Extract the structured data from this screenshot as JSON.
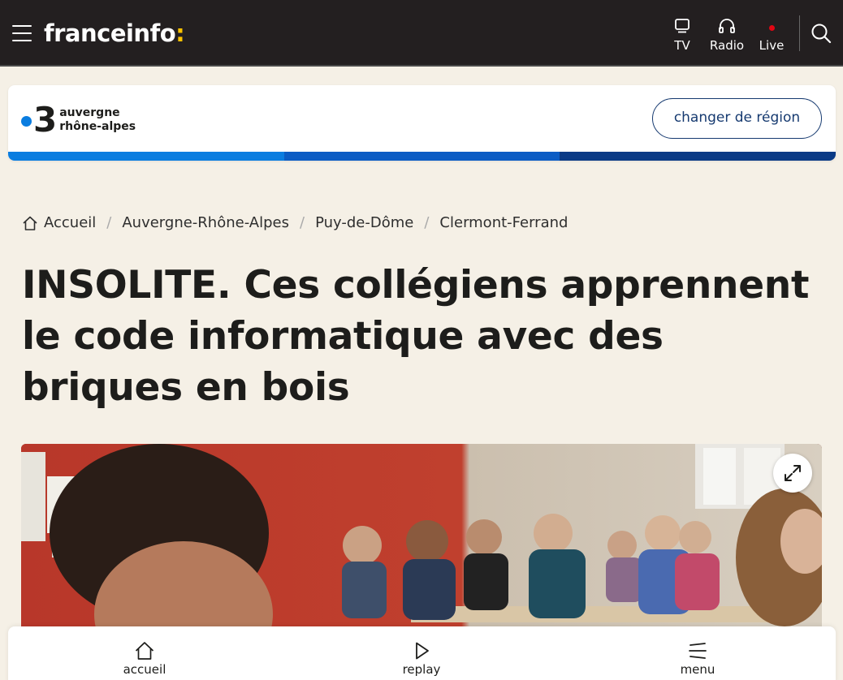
{
  "header": {
    "logo_text": "franceinfo",
    "logo_colon": ":",
    "tv_label": "TV",
    "radio_label": "Radio",
    "live_label": "Live"
  },
  "region": {
    "channel_number": "3",
    "name_line1": "auvergne",
    "name_line2": "rhône-alpes",
    "change_button": "changer de région",
    "stripe_colors": [
      "#0a7de0",
      "#0b5cc4",
      "#0a3a86"
    ]
  },
  "breadcrumb": {
    "items": [
      "Accueil",
      "Auvergne-Rhône-Alpes",
      "Puy-de-Dôme",
      "Clermont-Ferrand"
    ],
    "separator": "/"
  },
  "article": {
    "title": "INSOLITE. Ces collégiens apprennent le code informatique avec des briques en bois"
  },
  "media": {
    "alt": "classroom-photo",
    "expand_icon": "expand-icon"
  },
  "bottom_nav": {
    "accueil": "accueil",
    "replay": "replay",
    "menu": "menu"
  },
  "colors": {
    "header_bg": "#231f20",
    "page_bg": "#f5f0e6",
    "accent_blue": "#163a70",
    "logo_yellow": "#fdc300",
    "live_red": "#e20613"
  }
}
